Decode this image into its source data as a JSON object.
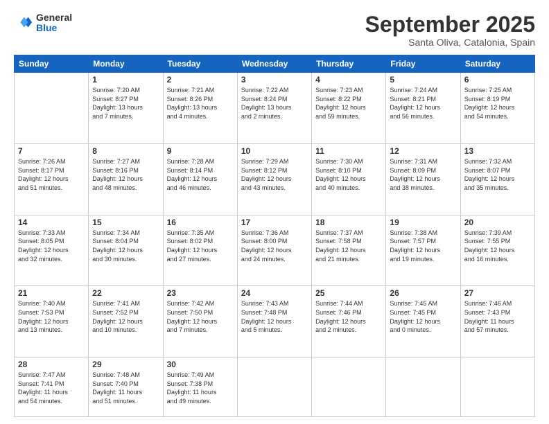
{
  "header": {
    "logo": {
      "general": "General",
      "blue": "Blue"
    },
    "title": "September 2025",
    "subtitle": "Santa Oliva, Catalonia, Spain"
  },
  "days_of_week": [
    "Sunday",
    "Monday",
    "Tuesday",
    "Wednesday",
    "Thursday",
    "Friday",
    "Saturday"
  ],
  "weeks": [
    [
      {
        "day": "",
        "info": ""
      },
      {
        "day": "1",
        "info": "Sunrise: 7:20 AM\nSunset: 8:27 PM\nDaylight: 13 hours\nand 7 minutes."
      },
      {
        "day": "2",
        "info": "Sunrise: 7:21 AM\nSunset: 8:26 PM\nDaylight: 13 hours\nand 4 minutes."
      },
      {
        "day": "3",
        "info": "Sunrise: 7:22 AM\nSunset: 8:24 PM\nDaylight: 13 hours\nand 2 minutes."
      },
      {
        "day": "4",
        "info": "Sunrise: 7:23 AM\nSunset: 8:22 PM\nDaylight: 12 hours\nand 59 minutes."
      },
      {
        "day": "5",
        "info": "Sunrise: 7:24 AM\nSunset: 8:21 PM\nDaylight: 12 hours\nand 56 minutes."
      },
      {
        "day": "6",
        "info": "Sunrise: 7:25 AM\nSunset: 8:19 PM\nDaylight: 12 hours\nand 54 minutes."
      }
    ],
    [
      {
        "day": "7",
        "info": "Sunrise: 7:26 AM\nSunset: 8:17 PM\nDaylight: 12 hours\nand 51 minutes."
      },
      {
        "day": "8",
        "info": "Sunrise: 7:27 AM\nSunset: 8:16 PM\nDaylight: 12 hours\nand 48 minutes."
      },
      {
        "day": "9",
        "info": "Sunrise: 7:28 AM\nSunset: 8:14 PM\nDaylight: 12 hours\nand 46 minutes."
      },
      {
        "day": "10",
        "info": "Sunrise: 7:29 AM\nSunset: 8:12 PM\nDaylight: 12 hours\nand 43 minutes."
      },
      {
        "day": "11",
        "info": "Sunrise: 7:30 AM\nSunset: 8:10 PM\nDaylight: 12 hours\nand 40 minutes."
      },
      {
        "day": "12",
        "info": "Sunrise: 7:31 AM\nSunset: 8:09 PM\nDaylight: 12 hours\nand 38 minutes."
      },
      {
        "day": "13",
        "info": "Sunrise: 7:32 AM\nSunset: 8:07 PM\nDaylight: 12 hours\nand 35 minutes."
      }
    ],
    [
      {
        "day": "14",
        "info": "Sunrise: 7:33 AM\nSunset: 8:05 PM\nDaylight: 12 hours\nand 32 minutes."
      },
      {
        "day": "15",
        "info": "Sunrise: 7:34 AM\nSunset: 8:04 PM\nDaylight: 12 hours\nand 30 minutes."
      },
      {
        "day": "16",
        "info": "Sunrise: 7:35 AM\nSunset: 8:02 PM\nDaylight: 12 hours\nand 27 minutes."
      },
      {
        "day": "17",
        "info": "Sunrise: 7:36 AM\nSunset: 8:00 PM\nDaylight: 12 hours\nand 24 minutes."
      },
      {
        "day": "18",
        "info": "Sunrise: 7:37 AM\nSunset: 7:58 PM\nDaylight: 12 hours\nand 21 minutes."
      },
      {
        "day": "19",
        "info": "Sunrise: 7:38 AM\nSunset: 7:57 PM\nDaylight: 12 hours\nand 19 minutes."
      },
      {
        "day": "20",
        "info": "Sunrise: 7:39 AM\nSunset: 7:55 PM\nDaylight: 12 hours\nand 16 minutes."
      }
    ],
    [
      {
        "day": "21",
        "info": "Sunrise: 7:40 AM\nSunset: 7:53 PM\nDaylight: 12 hours\nand 13 minutes."
      },
      {
        "day": "22",
        "info": "Sunrise: 7:41 AM\nSunset: 7:52 PM\nDaylight: 12 hours\nand 10 minutes."
      },
      {
        "day": "23",
        "info": "Sunrise: 7:42 AM\nSunset: 7:50 PM\nDaylight: 12 hours\nand 7 minutes."
      },
      {
        "day": "24",
        "info": "Sunrise: 7:43 AM\nSunset: 7:48 PM\nDaylight: 12 hours\nand 5 minutes."
      },
      {
        "day": "25",
        "info": "Sunrise: 7:44 AM\nSunset: 7:46 PM\nDaylight: 12 hours\nand 2 minutes."
      },
      {
        "day": "26",
        "info": "Sunrise: 7:45 AM\nSunset: 7:45 PM\nDaylight: 12 hours\nand 0 minutes."
      },
      {
        "day": "27",
        "info": "Sunrise: 7:46 AM\nSunset: 7:43 PM\nDaylight: 11 hours\nand 57 minutes."
      }
    ],
    [
      {
        "day": "28",
        "info": "Sunrise: 7:47 AM\nSunset: 7:41 PM\nDaylight: 11 hours\nand 54 minutes."
      },
      {
        "day": "29",
        "info": "Sunrise: 7:48 AM\nSunset: 7:40 PM\nDaylight: 11 hours\nand 51 minutes."
      },
      {
        "day": "30",
        "info": "Sunrise: 7:49 AM\nSunset: 7:38 PM\nDaylight: 11 hours\nand 49 minutes."
      },
      {
        "day": "",
        "info": ""
      },
      {
        "day": "",
        "info": ""
      },
      {
        "day": "",
        "info": ""
      },
      {
        "day": "",
        "info": ""
      }
    ]
  ]
}
